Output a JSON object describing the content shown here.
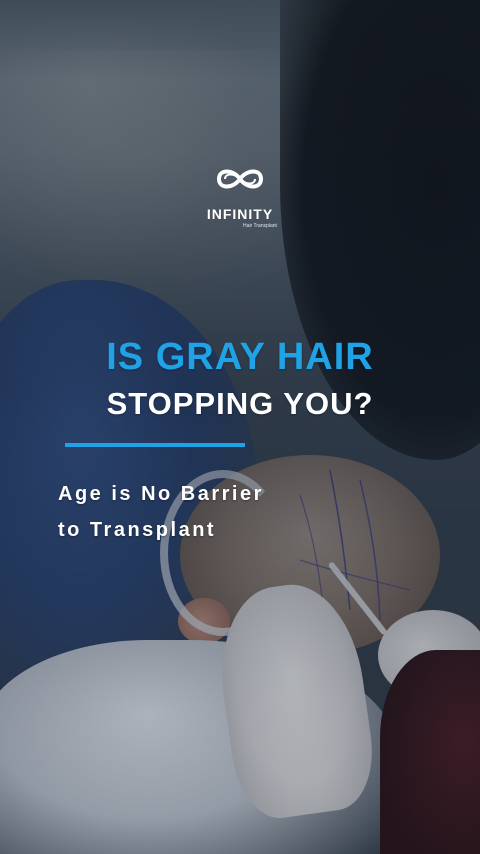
{
  "brand": {
    "name": "INFINITY",
    "tagline": "Hair Transplant",
    "logo_color": "#ffffff"
  },
  "headline": {
    "line1": "IS GRAY HAIR",
    "line2": "STOPPING YOU?",
    "accent_color": "#1fa3e6"
  },
  "subheadline": {
    "line1": "Age is No Barrier",
    "line2": "to Transplant"
  },
  "photo": {
    "icon": "hair-transplant-procedure-photo"
  }
}
